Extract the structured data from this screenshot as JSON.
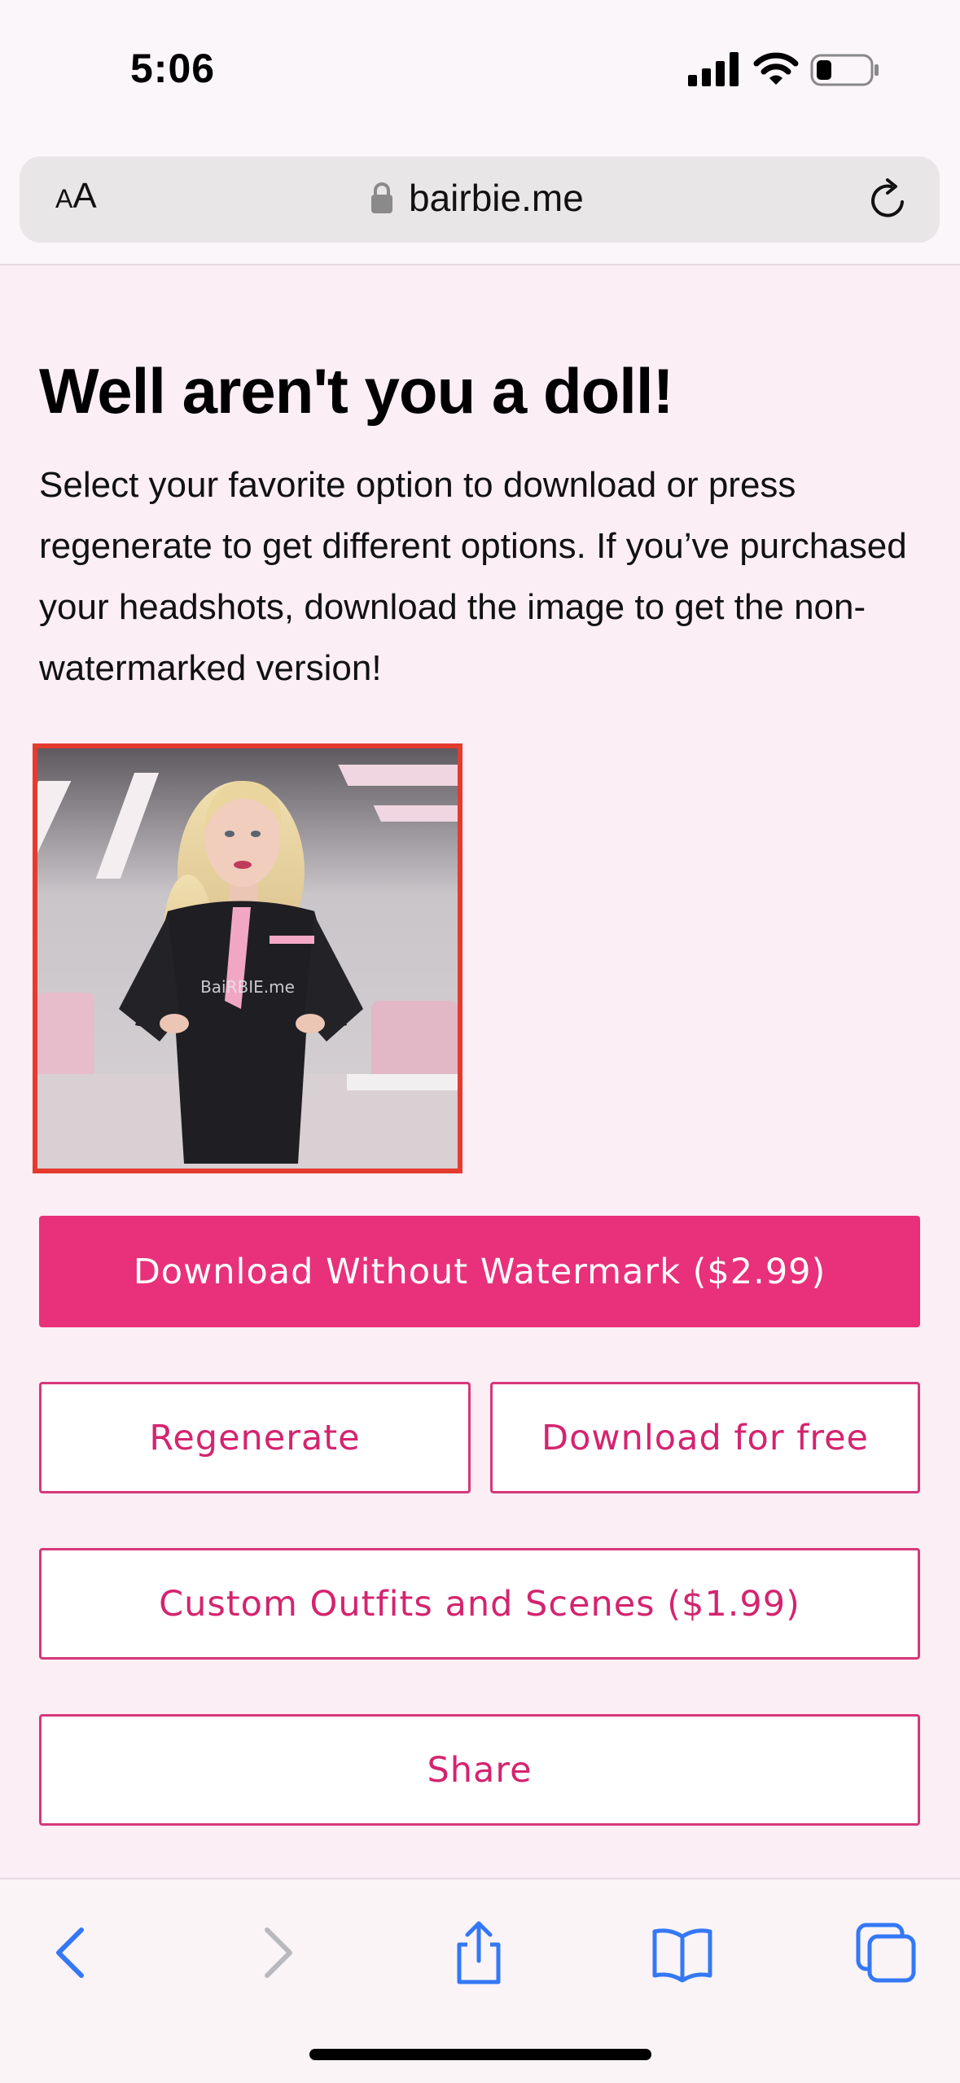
{
  "status_bar": {
    "time": "5:06"
  },
  "browser": {
    "text_size_label_small": "A",
    "text_size_label_large": "A",
    "url": "bairbie.me"
  },
  "page": {
    "headline": "Well aren't you a doll!",
    "description": "Select your favorite option to download or press regenerate to get different options. If you’ve purchased your headshots, download the image to get the non-watermarked version!",
    "image_watermark": "BaiRBIE.me",
    "buttons": {
      "download_paid": "Download Without Watermark ($2.99)",
      "regenerate": "Regenerate",
      "download_free": "Download for free",
      "custom_outfits": "Custom Outfits and Scenes ($1.99)",
      "share": "Share"
    }
  },
  "toolbar": {
    "icons": [
      "back-icon",
      "forward-icon",
      "share-icon",
      "bookmarks-icon",
      "tabs-icon"
    ]
  },
  "colors": {
    "accent": "#e8317a",
    "page_background": "#fbeef5",
    "image_border": "#e43b2f",
    "toolbar_blue": "#3478f6"
  }
}
